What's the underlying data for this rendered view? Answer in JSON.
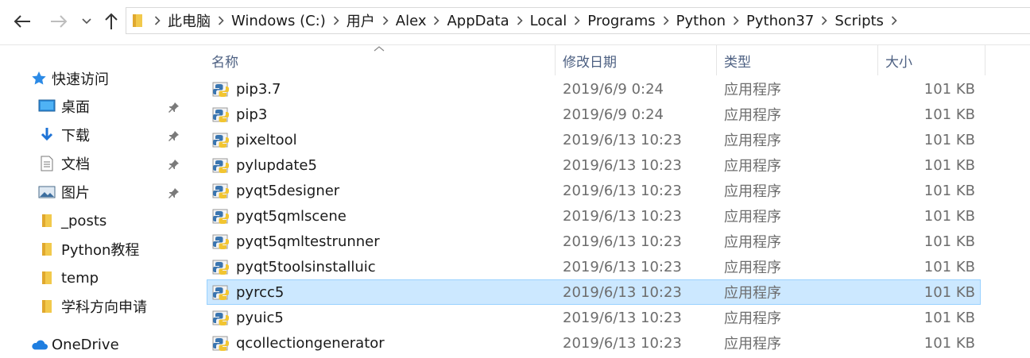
{
  "address_bar": {
    "breadcrumbs": [
      "此电脑",
      "Windows (C:)",
      "用户",
      "Alex",
      "AppData",
      "Local",
      "Programs",
      "Python",
      "Python37",
      "Scripts"
    ]
  },
  "sidebar": {
    "quick_access": "快速访问",
    "items": [
      {
        "label": "桌面",
        "icon": "desktop-icon",
        "pinned": true
      },
      {
        "label": "下载",
        "icon": "download-icon",
        "pinned": true
      },
      {
        "label": "文档",
        "icon": "document-icon",
        "pinned": true
      },
      {
        "label": "图片",
        "icon": "pictures-icon",
        "pinned": true
      },
      {
        "label": "_posts",
        "icon": "folder-icon",
        "pinned": false
      },
      {
        "label": "Python教程",
        "icon": "folder-icon",
        "pinned": false
      },
      {
        "label": "temp",
        "icon": "folder-icon",
        "pinned": false
      },
      {
        "label": "学科方向申请",
        "icon": "folder-icon",
        "pinned": false
      }
    ],
    "onedrive": "OneDrive"
  },
  "columns": {
    "name": "名称",
    "date": "修改日期",
    "type": "类型",
    "size": "大小"
  },
  "files": [
    {
      "name": "pip3.7",
      "date": "2019/6/9 0:24",
      "type": "应用程序",
      "size": "101 KB",
      "selected": false
    },
    {
      "name": "pip3",
      "date": "2019/6/9 0:24",
      "type": "应用程序",
      "size": "101 KB",
      "selected": false
    },
    {
      "name": "pixeltool",
      "date": "2019/6/13 10:23",
      "type": "应用程序",
      "size": "101 KB",
      "selected": false
    },
    {
      "name": "pylupdate5",
      "date": "2019/6/13 10:23",
      "type": "应用程序",
      "size": "101 KB",
      "selected": false
    },
    {
      "name": "pyqt5designer",
      "date": "2019/6/13 10:23",
      "type": "应用程序",
      "size": "101 KB",
      "selected": false
    },
    {
      "name": "pyqt5qmlscene",
      "date": "2019/6/13 10:23",
      "type": "应用程序",
      "size": "101 KB",
      "selected": false
    },
    {
      "name": "pyqt5qmltestrunner",
      "date": "2019/6/13 10:23",
      "type": "应用程序",
      "size": "101 KB",
      "selected": false
    },
    {
      "name": "pyqt5toolsinstalluic",
      "date": "2019/6/13 10:23",
      "type": "应用程序",
      "size": "101 KB",
      "selected": false
    },
    {
      "name": "pyrcc5",
      "date": "2019/6/13 10:23",
      "type": "应用程序",
      "size": "101 KB",
      "selected": true
    },
    {
      "name": "pyuic5",
      "date": "2019/6/13 10:23",
      "type": "应用程序",
      "size": "101 KB",
      "selected": false
    },
    {
      "name": "qcollectiongenerator",
      "date": "2019/6/13 10:23",
      "type": "应用程序",
      "size": "101 KB",
      "selected": false
    }
  ],
  "colors": {
    "selection": "#cce8ff",
    "selection_border": "#99d1ff",
    "header_text": "#4d6082"
  }
}
